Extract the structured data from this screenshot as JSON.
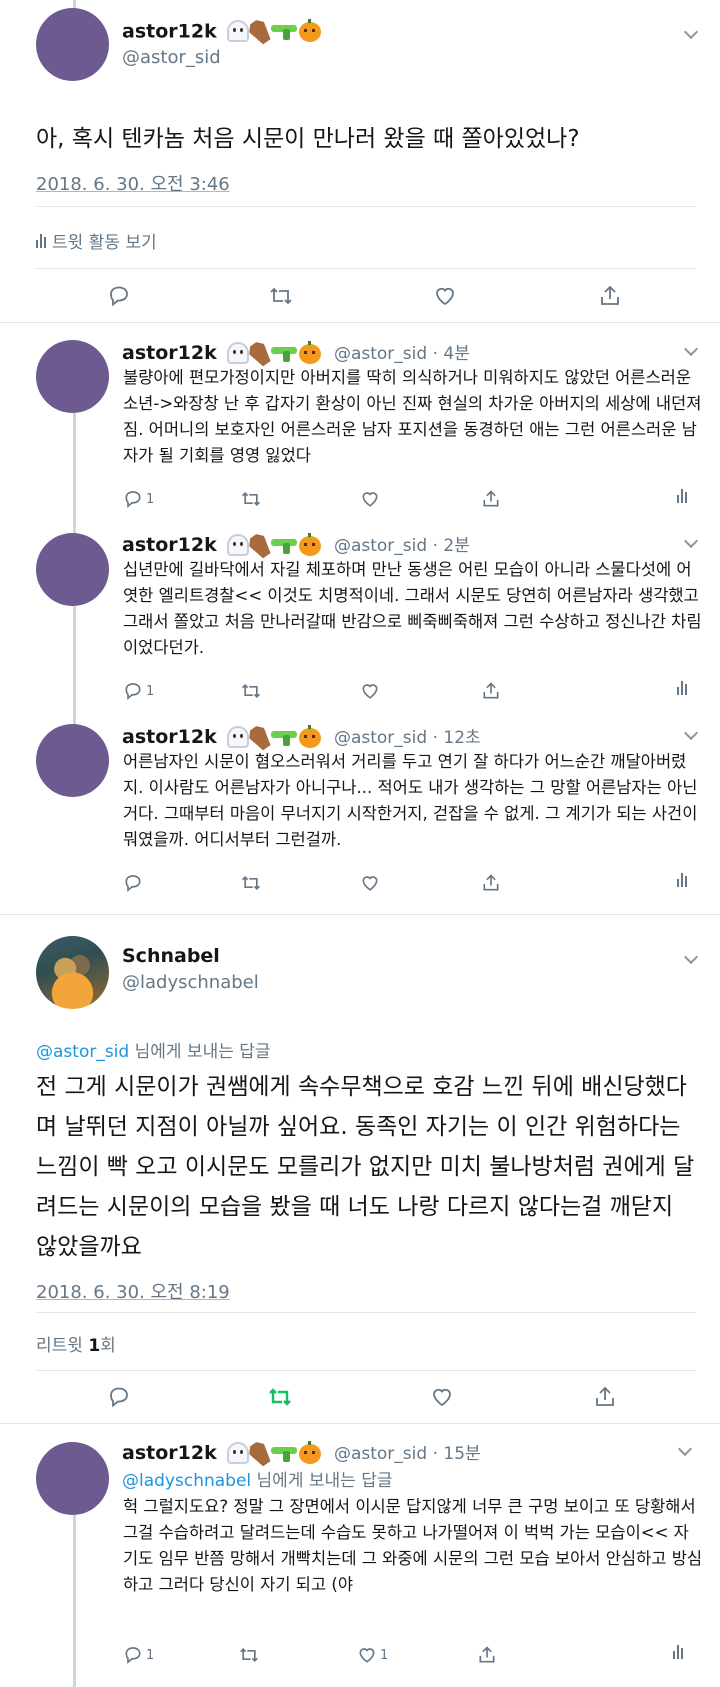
{
  "main_tweet": {
    "name": "astor12k",
    "handle": "@astor_sid",
    "text": "아, 혹시 텐카놈 처음 시문이 만나러 왔을 때 쫄아있었나?",
    "timestamp": "2018. 6. 30. 오전 3:46",
    "activity_label": "트윗 활동 보기"
  },
  "replies_top": [
    {
      "name": "astor12k",
      "handle_time": "@astor_sid · 4분",
      "text": "불량아에 편모가정이지만 아버지를 딱히 의식하거나 미워하지도 않았던 어른스러운 소년->와장창 난 후 갑자기 환상이 아닌 진짜 현실의 차가운 아버지의 세상에 내던져짐. 어머니의 보호자인 어른스러운 남자 포지션을 동경하던 애는 그런 어른스러운 남자가 될 기회를 영영 잃었다",
      "reply_count": "1"
    },
    {
      "name": "astor12k",
      "handle_time": "@astor_sid · 2분",
      "text": "십년만에 길바닥에서 자길 체포하며 만난 동생은 어린 모습이 아니라 스물다섯에 어엿한 엘리트경찰<< 이것도 치명적이네. 그래서 시문도 당연히 어른남자라 생각했고 그래서 쫄았고 처음 만나러갈때 반감으로 삐죽삐죽해져 그런 수상하고 정신나간 차림이었다던가.",
      "reply_count": "1"
    },
    {
      "name": "astor12k",
      "handle_time": "@astor_sid · 12초",
      "text": "어른남자인 시문이 혐오스러워서 거리를 두고 연기 잘 하다가 어느순간 깨달아버렸지. 이사람도 어른남자가 아니구나... 적어도 내가 생각하는 그 망할 어른남자는 아닌거다. 그때부터 마음이 무너지기 시작한거지, 걷잡을 수 없게. 그 계기가 되는 사건이 뭐였을까. 어디서부터 그런걸까.",
      "reply_count": ""
    }
  ],
  "schnabel_tweet": {
    "name": "Schnabel",
    "handle": "@ladyschnabel",
    "reply_to_handle": "@astor_sid",
    "reply_to_suffix": " 님에게 보내는 답글",
    "text": "전 그게 시문이가 권쌤에게 속수무책으로 호감 느낀 뒤에 배신당했다며 날뛰던 지점이 아닐까 싶어요. 동족인 자기는 이 인간 위험하다는 느낌이 빡 오고 이시문도 모를리가 없지만 미치 불나방처럼 권에게 달려드는 시문이의 모습을 봤을 때 너도 나랑 다르지 않다는걸 깨닫지 않았을까요",
    "timestamp": "2018. 6. 30. 오전 8:19",
    "retweet_label": "리트윗 ",
    "retweet_count": "1",
    "retweet_unit": "회"
  },
  "last_reply": {
    "name": "astor12k",
    "handle_time": "@astor_sid · 15분",
    "reply_to_handle": "@ladyschnabel",
    "reply_to_suffix": " 님에게 보내는 답글",
    "text": "헉 그럴지도요? 정말 그 장면에서 이시문 답지않게 너무 큰 구멍 보이고 또 당황해서 그걸 수습하려고 달려드는데 수습도 못하고 나가떨어져 이 벅벅 가는 모습이<< 자기도 임무 반쯤 망해서 개빡치는데 그 와중에 시문의 그런 모습 보아서 안심하고 방심하고 그러다 당신이 자기 되고 (야",
    "reply_count": "1",
    "like_count": "1"
  },
  "colors": {
    "retweet_active": "#17bf63",
    "link": "#1b95e0",
    "secondary_text": "#657786"
  }
}
